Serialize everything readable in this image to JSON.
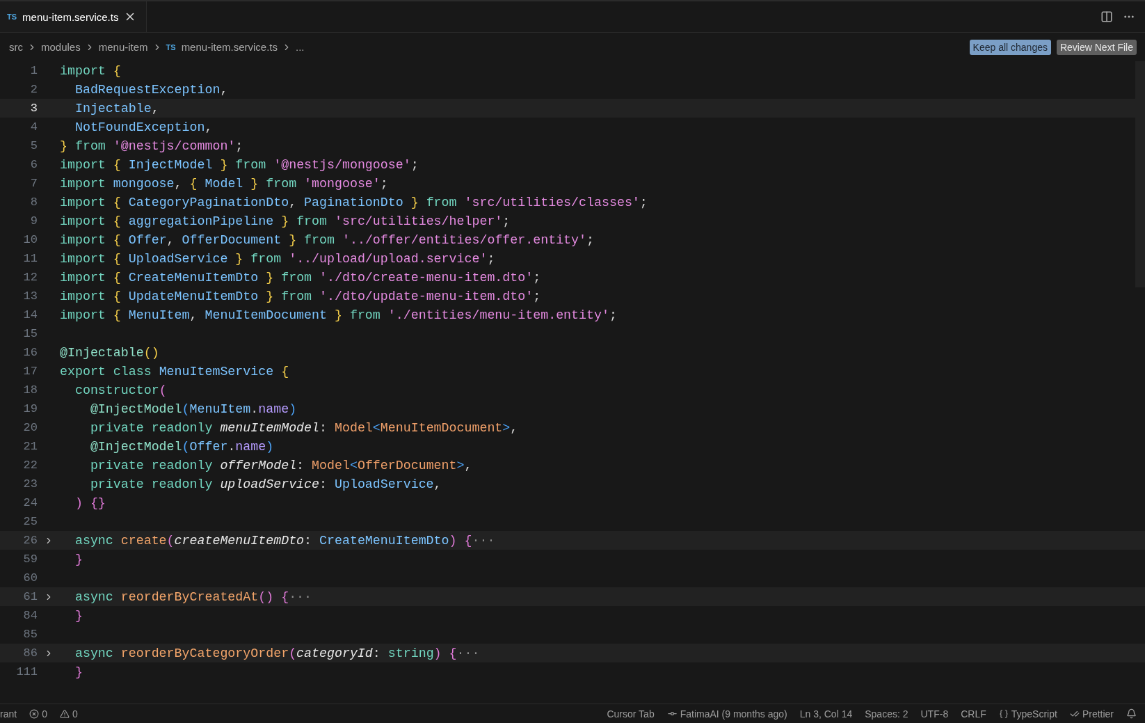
{
  "tabs": [
    {
      "badge": "TS",
      "label": "menu-item.service.ts",
      "selected": true
    }
  ],
  "breadcrumbs": [
    {
      "label": "src"
    },
    {
      "label": "modules"
    },
    {
      "label": "menu-item"
    },
    {
      "badge": "TS",
      "label": "menu-item.service.ts"
    },
    {
      "label": "..."
    }
  ],
  "actions": [
    {
      "label": "Keep all changes",
      "kind": "primary"
    },
    {
      "label": "Review Next File",
      "kind": "secondary"
    }
  ],
  "lines": [
    {
      "num": "1",
      "current": false,
      "folded": false,
      "tokens": [
        {
          "kind": "kw",
          "t": "import "
        },
        {
          "kind": "b1",
          "t": "{"
        }
      ]
    },
    {
      "num": "2",
      "current": false,
      "folded": false,
      "tokens": [
        {
          "kind": "id",
          "t": "  BadRequestException"
        },
        {
          "kind": "p",
          "t": ","
        }
      ]
    },
    {
      "num": "3",
      "current": true,
      "folded": false,
      "tokens": [
        {
          "kind": "id",
          "t": "  Injectable"
        },
        {
          "kind": "p",
          "t": ","
        }
      ]
    },
    {
      "num": "4",
      "current": false,
      "folded": false,
      "tokens": [
        {
          "kind": "id",
          "t": "  NotFoundException"
        },
        {
          "kind": "p",
          "t": ","
        }
      ]
    },
    {
      "num": "5",
      "current": false,
      "folded": false,
      "tokens": [
        {
          "kind": "b1",
          "t": "}"
        },
        {
          "kind": "kw",
          "t": " from "
        },
        {
          "kind": "str",
          "t": "'@nestjs/common'"
        },
        {
          "kind": "p",
          "t": ";"
        }
      ]
    },
    {
      "num": "6",
      "current": false,
      "folded": false,
      "tokens": [
        {
          "kind": "kw",
          "t": "import "
        },
        {
          "kind": "b1",
          "t": "{ "
        },
        {
          "kind": "id",
          "t": "InjectModel "
        },
        {
          "kind": "b1",
          "t": "}"
        },
        {
          "kind": "kw",
          "t": " from "
        },
        {
          "kind": "str",
          "t": "'@nestjs/mongoose'"
        },
        {
          "kind": "p",
          "t": ";"
        }
      ]
    },
    {
      "num": "7",
      "current": false,
      "folded": false,
      "tokens": [
        {
          "kind": "kw",
          "t": "import "
        },
        {
          "kind": "id",
          "t": "mongoose"
        },
        {
          "kind": "p",
          "t": ", "
        },
        {
          "kind": "b1",
          "t": "{ "
        },
        {
          "kind": "id",
          "t": "Model "
        },
        {
          "kind": "b1",
          "t": "}"
        },
        {
          "kind": "kw",
          "t": " from "
        },
        {
          "kind": "str",
          "t": "'mongoose'"
        },
        {
          "kind": "p",
          "t": ";"
        }
      ]
    },
    {
      "num": "8",
      "current": false,
      "folded": false,
      "tokens": [
        {
          "kind": "kw",
          "t": "import "
        },
        {
          "kind": "b1",
          "t": "{ "
        },
        {
          "kind": "id",
          "t": "CategoryPaginationDto"
        },
        {
          "kind": "p",
          "t": ", "
        },
        {
          "kind": "id",
          "t": "PaginationDto "
        },
        {
          "kind": "b1",
          "t": "}"
        },
        {
          "kind": "kw",
          "t": " from "
        },
        {
          "kind": "str",
          "t": "'src/utilities/classes'"
        },
        {
          "kind": "p",
          "t": ";"
        }
      ]
    },
    {
      "num": "9",
      "current": false,
      "folded": false,
      "tokens": [
        {
          "kind": "kw",
          "t": "import "
        },
        {
          "kind": "b1",
          "t": "{ "
        },
        {
          "kind": "id",
          "t": "aggregationPipeline "
        },
        {
          "kind": "b1",
          "t": "}"
        },
        {
          "kind": "kw",
          "t": " from "
        },
        {
          "kind": "str",
          "t": "'src/utilities/helper'"
        },
        {
          "kind": "p",
          "t": ";"
        }
      ]
    },
    {
      "num": "10",
      "current": false,
      "folded": false,
      "tokens": [
        {
          "kind": "kw",
          "t": "import "
        },
        {
          "kind": "b1",
          "t": "{ "
        },
        {
          "kind": "id",
          "t": "Offer"
        },
        {
          "kind": "p",
          "t": ", "
        },
        {
          "kind": "id",
          "t": "OfferDocument "
        },
        {
          "kind": "b1",
          "t": "}"
        },
        {
          "kind": "kw",
          "t": " from "
        },
        {
          "kind": "str",
          "t": "'../offer/entities/offer.entity'"
        },
        {
          "kind": "p",
          "t": ";"
        }
      ]
    },
    {
      "num": "11",
      "current": false,
      "folded": false,
      "tokens": [
        {
          "kind": "kw",
          "t": "import "
        },
        {
          "kind": "b1",
          "t": "{ "
        },
        {
          "kind": "id",
          "t": "UploadService "
        },
        {
          "kind": "b1",
          "t": "}"
        },
        {
          "kind": "kw",
          "t": " from "
        },
        {
          "kind": "str",
          "t": "'../upload/upload.service'"
        },
        {
          "kind": "p",
          "t": ";"
        }
      ]
    },
    {
      "num": "12",
      "current": false,
      "folded": false,
      "tokens": [
        {
          "kind": "kw",
          "t": "import "
        },
        {
          "kind": "b1",
          "t": "{ "
        },
        {
          "kind": "id",
          "t": "CreateMenuItemDto "
        },
        {
          "kind": "b1",
          "t": "}"
        },
        {
          "kind": "kw",
          "t": " from "
        },
        {
          "kind": "str",
          "t": "'./dto/create-menu-item.dto'"
        },
        {
          "kind": "p",
          "t": ";"
        }
      ]
    },
    {
      "num": "13",
      "current": false,
      "folded": false,
      "tokens": [
        {
          "kind": "kw",
          "t": "import "
        },
        {
          "kind": "b1",
          "t": "{ "
        },
        {
          "kind": "id",
          "t": "UpdateMenuItemDto "
        },
        {
          "kind": "b1",
          "t": "}"
        },
        {
          "kind": "kw",
          "t": " from "
        },
        {
          "kind": "str",
          "t": "'./dto/update-menu-item.dto'"
        },
        {
          "kind": "p",
          "t": ";"
        }
      ]
    },
    {
      "num": "14",
      "current": false,
      "folded": false,
      "tokens": [
        {
          "kind": "kw",
          "t": "import "
        },
        {
          "kind": "b1",
          "t": "{ "
        },
        {
          "kind": "id",
          "t": "MenuItem"
        },
        {
          "kind": "p",
          "t": ", "
        },
        {
          "kind": "id",
          "t": "MenuItemDocument "
        },
        {
          "kind": "b1",
          "t": "}"
        },
        {
          "kind": "kw",
          "t": " from "
        },
        {
          "kind": "str",
          "t": "'./entities/menu-item.entity'"
        },
        {
          "kind": "p",
          "t": ";"
        }
      ]
    },
    {
      "num": "15",
      "current": false,
      "folded": false
    },
    {
      "num": "16",
      "current": false,
      "folded": false,
      "tokens": [
        {
          "kind": "dec",
          "t": "@Injectable"
        },
        {
          "kind": "b1",
          "t": "()"
        }
      ]
    },
    {
      "num": "17",
      "current": false,
      "folded": false,
      "tokens": [
        {
          "kind": "kw",
          "t": "export class "
        },
        {
          "kind": "id",
          "t": "MenuItemService "
        },
        {
          "kind": "b1",
          "t": "{"
        }
      ]
    },
    {
      "num": "18",
      "current": false,
      "folded": false,
      "tokens": [
        {
          "kind": "kw",
          "t": "  constructor"
        },
        {
          "kind": "b2",
          "t": "("
        }
      ]
    },
    {
      "num": "19",
      "current": false,
      "folded": false,
      "tokens": [
        {
          "kind": "dec",
          "t": "    @InjectModel"
        },
        {
          "kind": "b3",
          "t": "("
        },
        {
          "kind": "id",
          "t": "MenuItem"
        },
        {
          "kind": "p",
          "t": "."
        },
        {
          "kind": "prop",
          "t": "name"
        },
        {
          "kind": "b3",
          "t": ")"
        }
      ]
    },
    {
      "num": "20",
      "current": false,
      "folded": false,
      "tokens": [
        {
          "kind": "kw",
          "t": "    private readonly "
        },
        {
          "kind": "param",
          "t": "menuItemModel"
        },
        {
          "kind": "p",
          "t": ": "
        },
        {
          "kind": "type",
          "t": "Model"
        },
        {
          "kind": "b3",
          "t": "<"
        },
        {
          "kind": "type",
          "t": "MenuItemDocument"
        },
        {
          "kind": "b3",
          "t": ">"
        },
        {
          "kind": "p",
          "t": ","
        }
      ]
    },
    {
      "num": "21",
      "current": false,
      "folded": false,
      "tokens": [
        {
          "kind": "dec",
          "t": "    @InjectModel"
        },
        {
          "kind": "b3",
          "t": "("
        },
        {
          "kind": "id",
          "t": "Offer"
        },
        {
          "kind": "p",
          "t": "."
        },
        {
          "kind": "prop",
          "t": "name"
        },
        {
          "kind": "b3",
          "t": ")"
        }
      ]
    },
    {
      "num": "22",
      "current": false,
      "folded": false,
      "tokens": [
        {
          "kind": "kw",
          "t": "    private readonly "
        },
        {
          "kind": "param",
          "t": "offerModel"
        },
        {
          "kind": "p",
          "t": ": "
        },
        {
          "kind": "type",
          "t": "Model"
        },
        {
          "kind": "b3",
          "t": "<"
        },
        {
          "kind": "type",
          "t": "OfferDocument"
        },
        {
          "kind": "b3",
          "t": ">"
        },
        {
          "kind": "p",
          "t": ","
        }
      ]
    },
    {
      "num": "23",
      "current": false,
      "folded": false,
      "tokens": [
        {
          "kind": "kw",
          "t": "    private readonly "
        },
        {
          "kind": "param",
          "t": "uploadService"
        },
        {
          "kind": "p",
          "t": ": "
        },
        {
          "kind": "id",
          "t": "UploadService"
        },
        {
          "kind": "p",
          "t": ","
        }
      ]
    },
    {
      "num": "24",
      "current": false,
      "folded": false,
      "tokens": [
        {
          "kind": "b2",
          "t": "  ) {}"
        }
      ]
    },
    {
      "num": "25",
      "current": false,
      "folded": false
    },
    {
      "num": "26",
      "current": false,
      "folded": true,
      "tokens": [
        {
          "kind": "kw",
          "t": "  async "
        },
        {
          "kind": "fn",
          "t": "create"
        },
        {
          "kind": "b2",
          "t": "("
        },
        {
          "kind": "param",
          "t": "createMenuItemDto"
        },
        {
          "kind": "p",
          "t": ": "
        },
        {
          "kind": "id",
          "t": "CreateMenuItemDto"
        },
        {
          "kind": "b2",
          "t": ") {"
        },
        {
          "kind": "fold",
          "t": "···"
        }
      ]
    },
    {
      "num": "59",
      "current": false,
      "folded": false,
      "tokens": [
        {
          "kind": "b2",
          "t": "  }"
        }
      ]
    },
    {
      "num": "60",
      "current": false,
      "folded": false
    },
    {
      "num": "61",
      "current": false,
      "folded": true,
      "tokens": [
        {
          "kind": "kw",
          "t": "  async "
        },
        {
          "kind": "fn",
          "t": "reorderByCreatedAt"
        },
        {
          "kind": "b2",
          "t": "() {"
        },
        {
          "kind": "fold",
          "t": "···"
        }
      ]
    },
    {
      "num": "84",
      "current": false,
      "folded": false,
      "tokens": [
        {
          "kind": "b2",
          "t": "  }"
        }
      ]
    },
    {
      "num": "85",
      "current": false,
      "folded": false
    },
    {
      "num": "86",
      "current": false,
      "folded": true,
      "tokens": [
        {
          "kind": "kw",
          "t": "  async "
        },
        {
          "kind": "fn",
          "t": "reorderByCategoryOrder"
        },
        {
          "kind": "b2",
          "t": "("
        },
        {
          "kind": "param",
          "t": "categoryId"
        },
        {
          "kind": "p",
          "t": ": "
        },
        {
          "kind": "kw",
          "t": "string"
        },
        {
          "kind": "b2",
          "t": ") {"
        },
        {
          "kind": "fold",
          "t": "···"
        }
      ]
    },
    {
      "num": "111",
      "current": false,
      "folded": false,
      "tokens": [
        {
          "kind": "b2",
          "t": "  }"
        }
      ]
    }
  ],
  "status_left": [
    {
      "kind": "text",
      "label": "rant"
    },
    {
      "kind": "error",
      "label": "0"
    },
    {
      "kind": "warning",
      "label": "0"
    }
  ],
  "status_right": [
    {
      "kind": "text",
      "label": "Cursor Tab"
    },
    {
      "kind": "commit",
      "label": "FatimaAI (9 months ago)"
    },
    {
      "kind": "text",
      "label": "Ln 3, Col 14"
    },
    {
      "kind": "text",
      "label": "Spaces: 2"
    },
    {
      "kind": "text",
      "label": "UTF-8"
    },
    {
      "kind": "text",
      "label": "CRLF"
    },
    {
      "kind": "braces",
      "label": "TypeScript"
    },
    {
      "kind": "check",
      "label": "Prettier"
    },
    {
      "kind": "bell"
    }
  ]
}
